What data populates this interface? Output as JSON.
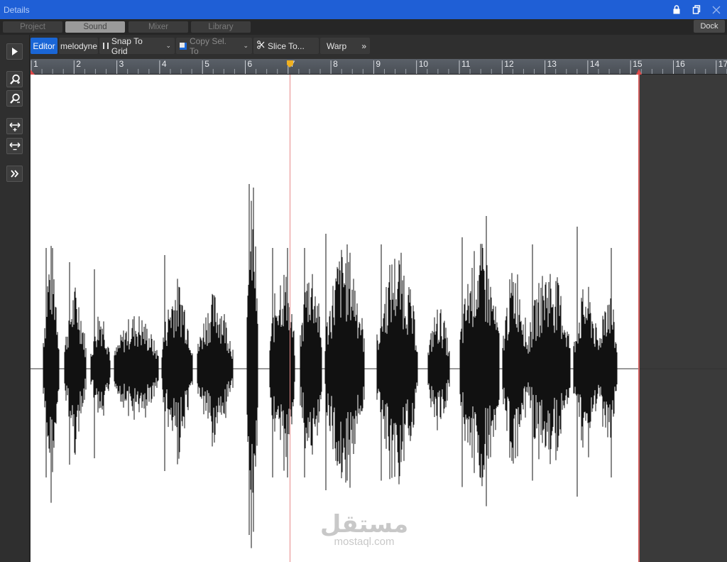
{
  "window": {
    "title": "Details",
    "controls": [
      "lock-icon",
      "restore-icon",
      "close-icon"
    ]
  },
  "tabs": [
    {
      "label": "Project",
      "active": false
    },
    {
      "label": "Sound",
      "active": true
    },
    {
      "label": "Mixer",
      "active": false
    },
    {
      "label": "Library",
      "active": false
    }
  ],
  "dock_label": "Dock",
  "left_tools": [
    "play-icon",
    "zoom-in-icon",
    "zoom-out-icon",
    "expand-horizontal-icon",
    "shrink-horizontal-icon",
    "more-icon"
  ],
  "toolbar": {
    "editor": "Editor",
    "melodyne": "melodyne",
    "snap": "Snap To Grid",
    "copy": "Copy Sel. To",
    "slice": "Slice To...",
    "warp": "Warp",
    "more": "»"
  },
  "ruler": {
    "labels": [
      "1",
      "2",
      "3",
      "4",
      "5",
      "6",
      "7",
      "8",
      "9",
      "10",
      "11",
      "12",
      "13",
      "14",
      "15",
      "16",
      "17"
    ],
    "playhead_bar": 7,
    "region_end_bar": 15
  },
  "colors": {
    "titlebar": "#1f5fd6",
    "editor_active": "#1a66d6",
    "waveform": "#111111",
    "playhead": "#e88a8a"
  },
  "watermark": {
    "arabic": "مستقل",
    "latin": "mostaql.com"
  }
}
